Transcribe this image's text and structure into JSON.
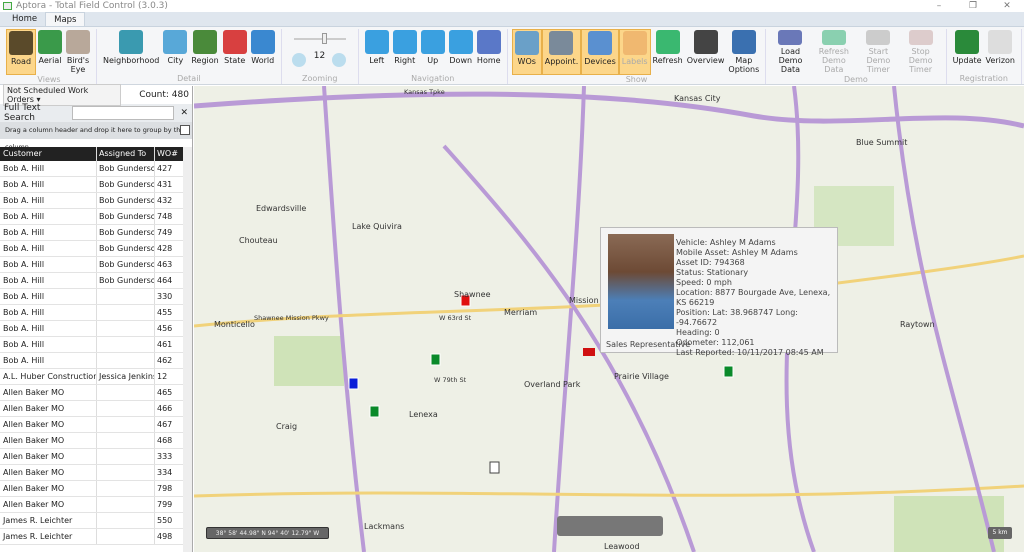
{
  "window": {
    "title": "Aptora - Total Field Control (3.0.3)",
    "controls": [
      "–",
      "❐",
      "✕"
    ]
  },
  "tabs": [
    "Home",
    "Maps"
  ],
  "ribbon": {
    "groups": [
      {
        "label": "Views",
        "buttons": [
          {
            "label": "Road",
            "on": true,
            "color": "#5a4a2a"
          },
          {
            "label": "Aerial",
            "color": "#3a9a4a"
          },
          {
            "label": "Bird's Eye",
            "color": "#b8a89a"
          }
        ]
      },
      {
        "label": "Detail",
        "buttons": [
          {
            "label": "Neighborhood",
            "color": "#3a9ab0"
          },
          {
            "label": "City",
            "color": "#58a8d8"
          },
          {
            "label": "Region",
            "color": "#4a8a3a"
          },
          {
            "label": "State",
            "color": "#d84040"
          },
          {
            "label": "World",
            "color": "#3a88d0"
          }
        ]
      },
      {
        "label": "Zooming",
        "zoom_level": "12"
      },
      {
        "label": "Navigation",
        "buttons": [
          {
            "label": "Left",
            "color": "#3aa0e0"
          },
          {
            "label": "Right",
            "color": "#3aa0e0"
          },
          {
            "label": "Up",
            "color": "#3aa0e0"
          },
          {
            "label": "Down",
            "color": "#3aa0e0"
          },
          {
            "label": "Home",
            "color": "#5a78c8"
          }
        ]
      },
      {
        "label": "Show",
        "buttons": [
          {
            "label": "WOs",
            "on": true,
            "color": "#6aa0c8"
          },
          {
            "label": "Appoint.",
            "on": true,
            "color": "#7a8a9a"
          },
          {
            "label": "Devices",
            "on": true,
            "color": "#5a90d0"
          },
          {
            "label": "Labels",
            "on": true,
            "dis": true,
            "color": "#f0b870"
          },
          {
            "label": "Refresh",
            "color": "#3ab870"
          },
          {
            "label": "Overview",
            "color": "#444"
          },
          {
            "label": "Map Options",
            "color": "#3a70b0"
          }
        ]
      },
      {
        "label": "Demo",
        "buttons": [
          {
            "label": "Load Demo Data",
            "color": "#6a78b8"
          },
          {
            "label": "Refresh Demo Data",
            "dis": true,
            "color": "#8ad0b0"
          },
          {
            "label": "Start Demo Timer",
            "dis": true,
            "color": "#ccc"
          },
          {
            "label": "Stop Demo Timer",
            "dis": true,
            "color": "#dcc"
          }
        ]
      },
      {
        "label": "Registration",
        "buttons": [
          {
            "label": "Update",
            "color": "#2a8a3a"
          },
          {
            "label": "Verizon",
            "color": "#ddd"
          }
        ]
      }
    ]
  },
  "filter": {
    "selected": "Not Scheduled Work Orders",
    "count": "Count: 480"
  },
  "search": {
    "label": "Full Text Search",
    "value": "",
    "clear": "✕"
  },
  "group_hint": "Drag a column header and drop it here to group by that column",
  "grid": {
    "headers": [
      "Customer",
      "Assigned To",
      "WO#"
    ],
    "rows": [
      [
        "Bob A. Hill",
        "Bob Gunderson",
        "427"
      ],
      [
        "Bob A. Hill",
        "Bob Gunderson",
        "431"
      ],
      [
        "Bob A. Hill",
        "Bob Gunderson",
        "432"
      ],
      [
        "Bob A. Hill",
        "Bob Gunderson",
        "748"
      ],
      [
        "Bob A. Hill",
        "Bob Gunderson",
        "749"
      ],
      [
        "Bob A. Hill",
        "Bob Gunderson",
        "428"
      ],
      [
        "Bob A. Hill",
        "Bob Gunderson",
        "463"
      ],
      [
        "Bob A. Hill",
        "Bob Gunderson",
        "464"
      ],
      [
        "Bob A. Hill",
        "",
        "330"
      ],
      [
        "Bob A. Hill",
        "",
        "455"
      ],
      [
        "Bob A. Hill",
        "",
        "456"
      ],
      [
        "Bob A. Hill",
        "",
        "461"
      ],
      [
        "Bob A. Hill",
        "",
        "462"
      ],
      [
        "A.L. Huber Construction Inc",
        "Jessica Jenkins",
        "12"
      ],
      [
        "Allen Baker MO",
        "",
        "465"
      ],
      [
        "Allen Baker MO",
        "",
        "466"
      ],
      [
        "Allen Baker MO",
        "",
        "467"
      ],
      [
        "Allen Baker MO",
        "",
        "468"
      ],
      [
        "Allen Baker MO",
        "",
        "333"
      ],
      [
        "Allen Baker MO",
        "",
        "334"
      ],
      [
        "Allen Baker MO",
        "",
        "798"
      ],
      [
        "Allen Baker MO",
        "",
        "799"
      ],
      [
        "James R. Leichter",
        "",
        "550"
      ],
      [
        "James R. Leichter",
        "",
        "498"
      ]
    ]
  },
  "map": {
    "places": [
      "Kansas City",
      "Edwardsville",
      "Lake Quivira",
      "Chouteau",
      "Monticello",
      "Shawnee",
      "Merriam",
      "Mission",
      "Overland Park",
      "Prairie Village",
      "Lenexa",
      "Craig",
      "Lackmans",
      "Leawood",
      "Raytown",
      "Blue Summit",
      "Kansas Tpke",
      "Shawnee Mission Pkwy",
      "W 63rd St",
      "W 79th St"
    ],
    "popup": {
      "lines": [
        "Vehicle: Ashley M Adams",
        "Mobile Asset: Ashley M Adams",
        "Asset ID: 794368",
        "Status: Stationary",
        "Speed: 0 mph",
        "Location: 8877 Bourgade Ave, Lenexa, KS 66219",
        "Position: Lat: 38.968747 Long: -94.76672",
        "Heading: 0",
        "Odometer: 112,061",
        "Last Reported: 10/11/2017 08:45 AM"
      ],
      "role": "Sales Representative"
    },
    "coordinates": "38° 58' 44.98\" N 94° 40' 12.79\" W",
    "scale": "5 km"
  }
}
